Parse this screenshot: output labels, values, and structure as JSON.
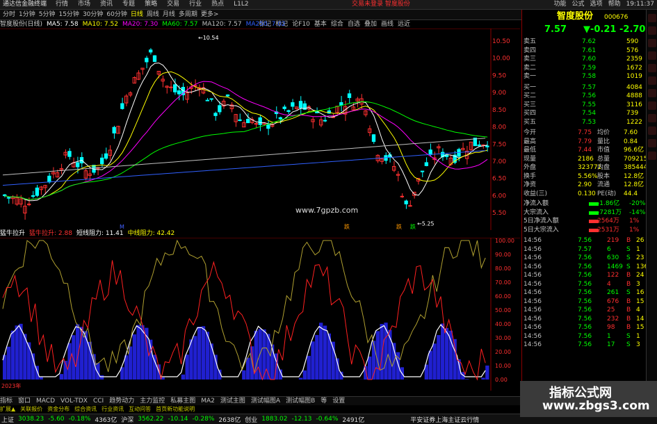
{
  "app": {
    "title": "通达信金融终端",
    "menus": [
      "行情",
      "市场",
      "资讯",
      "专题",
      "策略",
      "交易",
      "行业",
      "热点",
      "L1L2"
    ],
    "login_info": "交易未登录   智度股份",
    "top_right": [
      "功能",
      "公式",
      "选项",
      "帮助",
      "19:11:37"
    ]
  },
  "periods": [
    "分时",
    "1分钟",
    "5分钟",
    "15分钟",
    "30分钟",
    "60分钟",
    "日线",
    "周线",
    "月线",
    "多周期",
    "更多>"
  ],
  "active_period": "日线",
  "right_tools": [
    "标记",
    "标记",
    "论F10",
    "基本",
    "综合",
    "自选",
    "叠加",
    "画线",
    "远近"
  ],
  "stock": {
    "name": "智度股份",
    "code": "000676",
    "label": "智度股份(日线)"
  },
  "ma": [
    {
      "label": "MA5: 7.58",
      "color": "#ffffff"
    },
    {
      "label": "MA10: 7.52",
      "color": "#ffff00"
    },
    {
      "label": "MA20: 7.30",
      "color": "#ff00ff"
    },
    {
      "label": "MA60: 7.57",
      "color": "#00ff00"
    },
    {
      "label": "MA120: 7.57",
      "color": "#c0c0c0"
    },
    {
      "label": "MA250: 7.02",
      "color": "#3060ff"
    }
  ],
  "price_axis": [
    "10.50",
    "10.00",
    "9.50",
    "9.00",
    "8.50",
    "8.00",
    "7.50",
    "7.00",
    "6.50",
    "6.00",
    "5.50"
  ],
  "peak_label": "10.54",
  "low_label": "5.25",
  "markers": [
    "M",
    "跌",
    "跌",
    "跌"
  ],
  "indicator": {
    "name": "猛牛拉升",
    "value1": "猛牛拉升: 2.88",
    "value2": "短线阻力: 11.41",
    "value3": "中线阻力: 42.42"
  },
  "ind_axis": [
    "100.00",
    "90.00",
    "80.00",
    "70.00",
    "60.00",
    "50.00",
    "40.00",
    "30.00",
    "20.00",
    "10.00",
    "0.00"
  ],
  "date_label": "2023年",
  "bottom_tabs": [
    "指标",
    "窗口",
    "MACD",
    "VOL-TDX",
    "CCI",
    "趋势动力",
    "主力监控",
    "私募主图",
    "MA2",
    "测试主图",
    "测试幅图A",
    "测试幅图B",
    "等",
    "设置"
  ],
  "sub_tabs": [
    "扩展▲",
    "关联报价",
    "资金分布",
    "综合资讯",
    "行业资讯",
    "互动问答",
    "首页新功能说明"
  ],
  "quote": {
    "price": "7.57",
    "change": "▼-0.21",
    "pct": "-2.70%"
  },
  "asks": [
    [
      "卖五",
      "7.62",
      "590"
    ],
    [
      "卖四",
      "7.61",
      "576"
    ],
    [
      "卖三",
      "7.60",
      "2359"
    ],
    [
      "卖二",
      "7.59",
      "1672"
    ],
    [
      "卖一",
      "7.58",
      "1019"
    ]
  ],
  "bids": [
    [
      "买一",
      "7.57",
      "4084"
    ],
    [
      "买二",
      "7.56",
      "4888"
    ],
    [
      "买三",
      "7.55",
      "3116"
    ],
    [
      "买四",
      "7.54",
      "739"
    ],
    [
      "买五",
      "7.53",
      "1222"
    ]
  ],
  "stats": [
    [
      "今开",
      "7.75",
      "均价",
      "7.60"
    ],
    [
      "最高",
      "7.79",
      "量比",
      "0.84"
    ],
    [
      "最低",
      "7.44",
      "市值",
      "96.6亿"
    ],
    [
      "现量",
      "2186",
      "总量",
      "709215"
    ],
    [
      "外盘",
      "323771",
      "内盘",
      "385444"
    ],
    [
      "换手",
      "5.56%",
      "股本",
      "12.8亿"
    ],
    [
      "净资",
      "2.90",
      "流通",
      "12.8亿"
    ],
    [
      "收益(三)",
      "0.130",
      "PE(动)",
      "44.4"
    ]
  ],
  "flows": [
    [
      "净流入额",
      "-1.86亿",
      "-20%"
    ],
    [
      "大宗流入",
      "-7281万",
      "-14%"
    ],
    [
      "5日净流入额",
      "2564万",
      "1%"
    ],
    [
      "5日大宗流入",
      "2531万",
      "1%"
    ]
  ],
  "ticks": [
    [
      "14:56",
      "7.56",
      "219",
      "B",
      "26"
    ],
    [
      "14:56",
      "7.57",
      "6",
      "S",
      "1"
    ],
    [
      "14:56",
      "7.56",
      "630",
      "S",
      "23"
    ],
    [
      "14:56",
      "7.56",
      "1469",
      "S",
      "136"
    ],
    [
      "14:56",
      "7.56",
      "122",
      "B",
      "24"
    ],
    [
      "14:56",
      "7.56",
      "4",
      "B",
      "3"
    ],
    [
      "14:56",
      "7.56",
      "261",
      "S",
      "16"
    ],
    [
      "14:56",
      "7.56",
      "676",
      "B",
      "15"
    ],
    [
      "14:56",
      "7.56",
      "25",
      "B",
      "4"
    ],
    [
      "14:56",
      "7.56",
      "232",
      "B",
      "14"
    ],
    [
      "14:56",
      "7.56",
      "98",
      "B",
      "15"
    ],
    [
      "14:56",
      "7.56",
      "1",
      "S",
      "1"
    ],
    [
      "14:56",
      "7.56",
      "17",
      "S",
      "3"
    ]
  ],
  "status": [
    {
      "label": "上证",
      "value": "3038.23",
      "chg": "-5.60",
      "pct": "-0.18%",
      "vol": "4363亿"
    },
    {
      "label": "沪深",
      "value": "3562.22",
      "chg": "-10.14",
      "pct": "-0.28%",
      "vol": "2638亿"
    },
    {
      "label": "创业",
      "value": "1883.02",
      "chg": "-12.13",
      "pct": "-0.64%",
      "vol": "2491亿"
    }
  ],
  "status_right": "平安证券上海主证云行情",
  "watermark": {
    "center": "www.7gpzb.com",
    "line1": "指标公式网",
    "line2": "www.zbgs3.com"
  },
  "colors": {
    "up": "#ff3030",
    "down": "#00ffff",
    "blue": "#3030ff",
    "yellow": "#ffff00"
  }
}
